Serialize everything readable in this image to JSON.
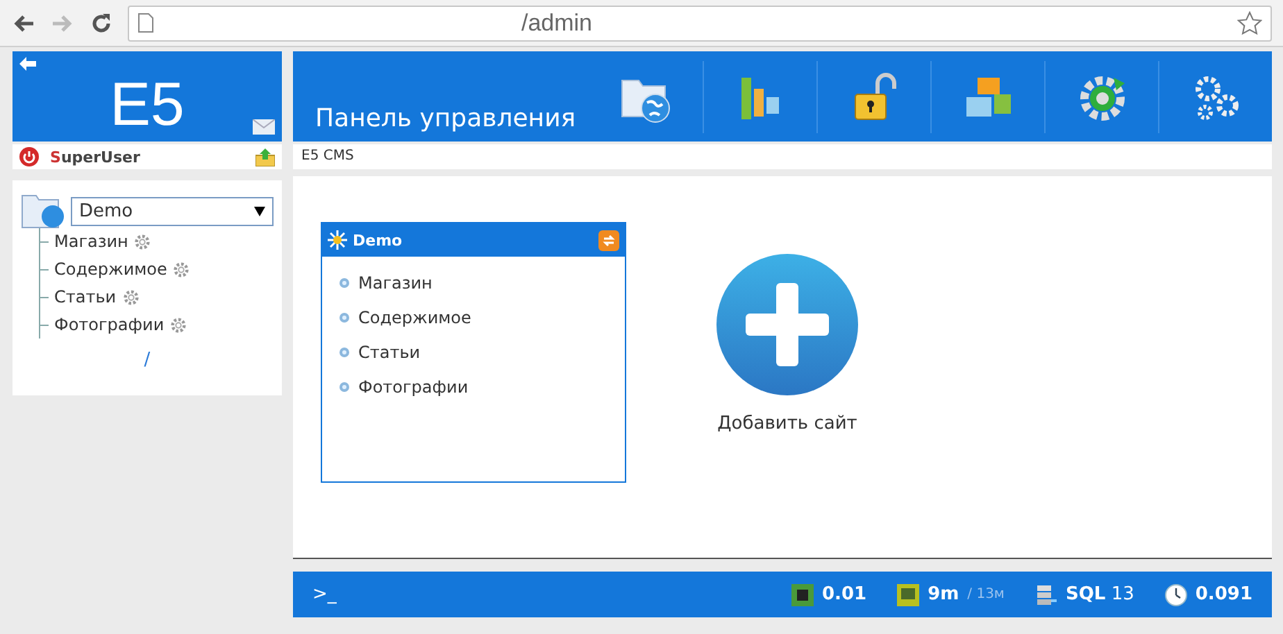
{
  "browser": {
    "url": "/admin"
  },
  "sidebar": {
    "logo": "E5",
    "user": "SuperUser",
    "site_select": {
      "value": "Demo"
    },
    "tree": [
      {
        "label": "Магазин"
      },
      {
        "label": "Содержимое"
      },
      {
        "label": "Статьи"
      },
      {
        "label": "Фотографии"
      }
    ],
    "root_link": "/"
  },
  "header": {
    "title": "Панель управления",
    "toolbar": [
      {
        "kind": "sites"
      },
      {
        "kind": "stats"
      },
      {
        "kind": "lock"
      },
      {
        "kind": "modules"
      },
      {
        "kind": "update"
      },
      {
        "kind": "settings"
      }
    ]
  },
  "breadcrumb": "E5 CMS",
  "site_card": {
    "title": "Demo",
    "items": [
      {
        "label": "Магазин"
      },
      {
        "label": "Содержимое"
      },
      {
        "label": "Статьи"
      },
      {
        "label": "Фотографии"
      }
    ]
  },
  "add_site": {
    "label": "Добавить сайт"
  },
  "status_bar": {
    "prompt": ">_",
    "cpu": "0.01",
    "memory": "9m",
    "memory_total": "/ 13м",
    "sql": "**SQL** 13",
    "time": "0.091"
  }
}
